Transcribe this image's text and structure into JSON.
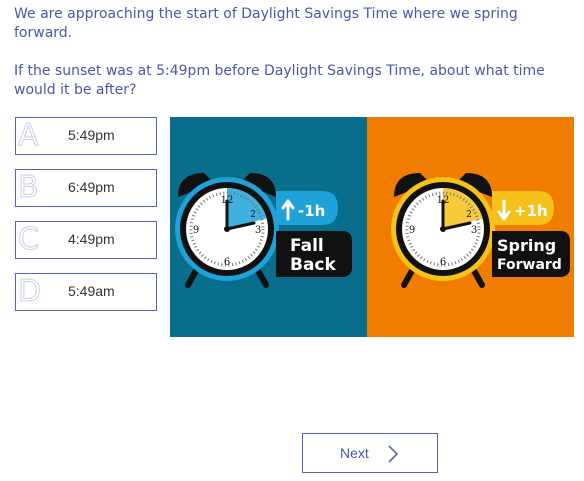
{
  "question": {
    "intro": "We are approaching the start of Daylight Savings Time where we spring forward.",
    "prompt": "If the sunset was at 5:49pm before Daylight Savings Time, about what time would it be after?"
  },
  "options": [
    {
      "letter": "A",
      "text": "5:49pm"
    },
    {
      "letter": "B",
      "text": "6:49pm"
    },
    {
      "letter": "C",
      "text": "4:49pm"
    },
    {
      "letter": "D",
      "text": "5:49am"
    }
  ],
  "illustration": {
    "left": {
      "badge": "-1h",
      "line1": "Fall",
      "line2": "Back",
      "panel_color": "#086e8c",
      "accent_color": "#1ea2d9"
    },
    "right": {
      "badge": "+1h",
      "line1": "Spring",
      "line2": "Forward",
      "panel_color": "#f07d00",
      "accent_color": "#f6c11a"
    },
    "clock_numbers": {
      "twelve": "12",
      "three": "3",
      "six": "6",
      "nine": "9",
      "two": "2"
    }
  },
  "next": {
    "label": "Next"
  },
  "colors": {
    "accent": "#4a58a8",
    "border": "#5665b3"
  }
}
